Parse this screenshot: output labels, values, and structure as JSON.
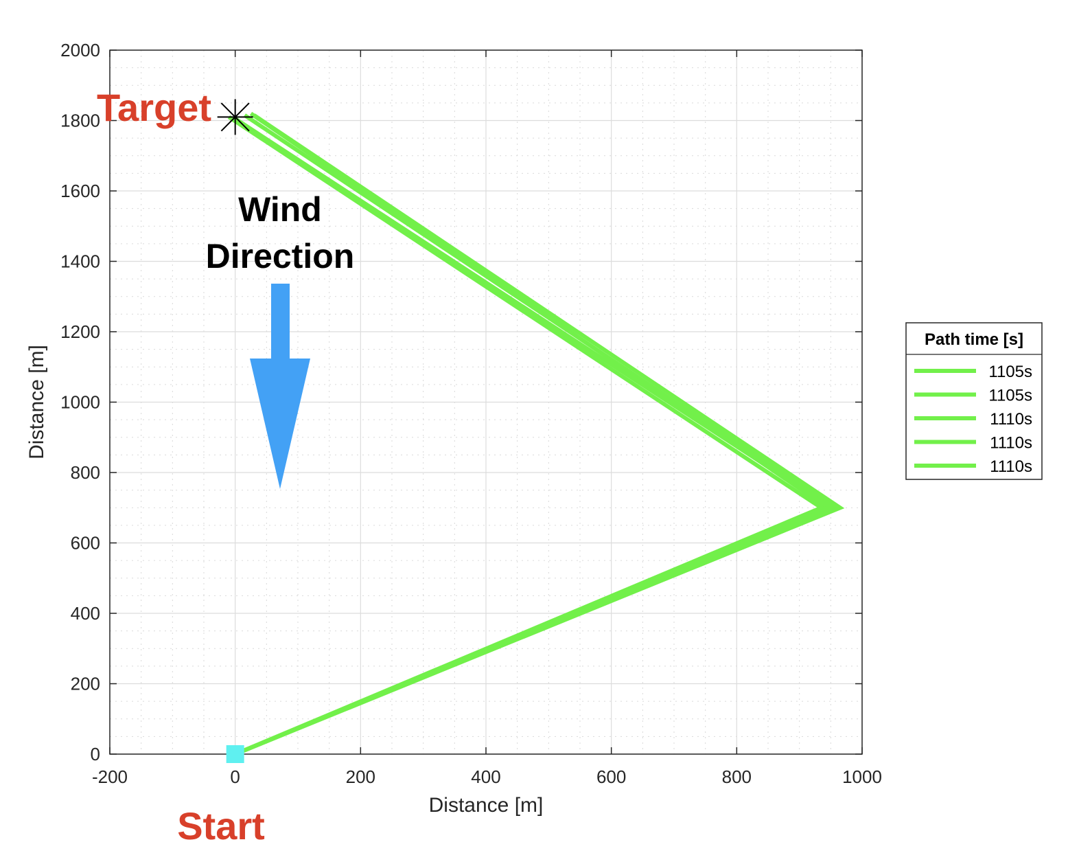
{
  "chart_data": {
    "type": "line",
    "title": "",
    "xlabel": "Distance [m]",
    "ylabel": "Distance [m]",
    "xlim": [
      -200,
      1000
    ],
    "ylim": [
      0,
      2000
    ],
    "xticks": [
      -200,
      0,
      200,
      400,
      600,
      800,
      1000
    ],
    "yticks": [
      0,
      200,
      400,
      600,
      800,
      1000,
      1200,
      1400,
      1600,
      1800,
      2000
    ],
    "xtick_labels": [
      "-200",
      "0",
      "200",
      "400",
      "600",
      "800",
      "1000"
    ],
    "ytick_labels": [
      "0",
      "200",
      "400",
      "600",
      "800",
      "1000",
      "1200",
      "1400",
      "1600",
      "1800",
      "2000"
    ],
    "grid": true,
    "minor_grid": true,
    "legend_title": "Path time [s]",
    "legend_position": "outside-right",
    "line_color": "#72f04a",
    "series": [
      {
        "name": "1105s",
        "x": [
          0,
          945,
          25
        ],
        "y": [
          0,
          700,
          1820
        ]
      },
      {
        "name": "1105s",
        "x": [
          0,
          955,
          15
        ],
        "y": [
          0,
          700,
          1815
        ]
      },
      {
        "name": "1110s",
        "x": [
          0,
          935,
          -10
        ],
        "y": [
          0,
          700,
          1810
        ]
      },
      {
        "name": "1110s",
        "x": [
          0,
          965,
          30
        ],
        "y": [
          0,
          700,
          1815
        ]
      },
      {
        "name": "1110s",
        "x": [
          0,
          950,
          0
        ],
        "y": [
          0,
          700,
          1805
        ]
      }
    ],
    "markers": [
      {
        "name": "start",
        "shape": "square",
        "color": "#5ff0f0",
        "x": 0,
        "y": 0
      },
      {
        "name": "target",
        "shape": "asterisk",
        "color": "#000000",
        "x": 0,
        "y": 1810
      }
    ],
    "annotations": {
      "target_label": "Target",
      "start_label": "Start",
      "wind_label_line1": "Wind",
      "wind_label_line2": "Direction",
      "wind_arrow_color": "#43a1f5",
      "wind_arrow_direction": "down"
    }
  }
}
